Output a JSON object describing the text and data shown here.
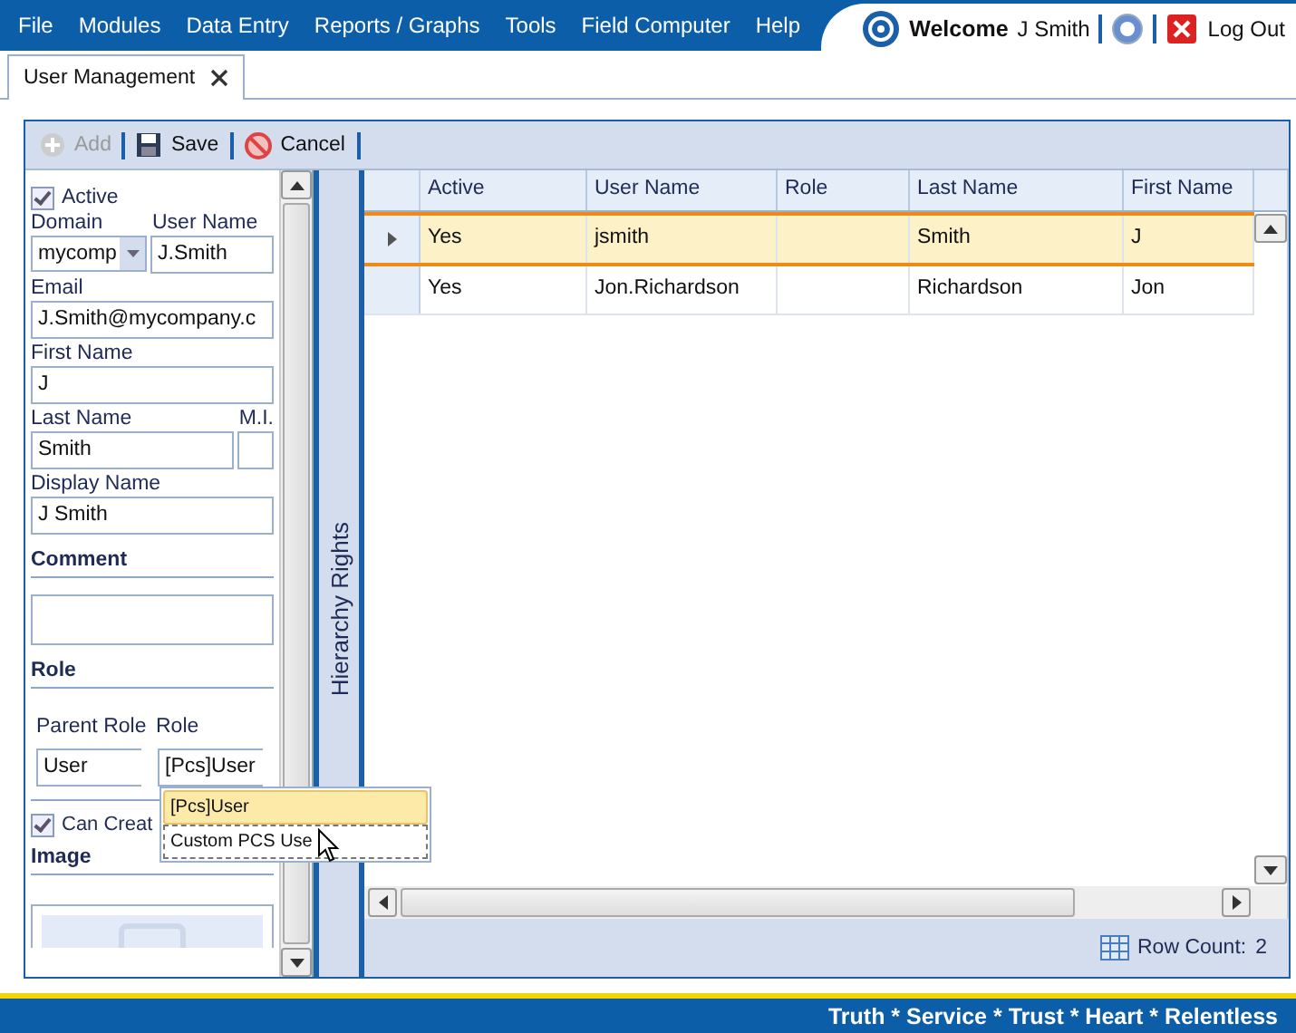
{
  "menu": [
    "File",
    "Modules",
    "Data Entry",
    "Reports / Graphs",
    "Tools",
    "Field Computer",
    "Help"
  ],
  "user": {
    "welcome": "Welcome",
    "name": "J Smith",
    "logout": "Log Out"
  },
  "tabs": [
    {
      "label": "User Management",
      "selected": true
    }
  ],
  "toolbar": [
    {
      "label": "Add",
      "kind": "add",
      "disabled": true
    },
    {
      "label": "Save",
      "kind": "save",
      "disabled": false
    },
    {
      "label": "Cancel",
      "kind": "cancel",
      "disabled": false
    }
  ],
  "form": {
    "active": {
      "label": "Active",
      "checked": true
    },
    "domain": {
      "label": "Domain",
      "value": "mycomp"
    },
    "user_name": {
      "label": "User Name",
      "value": "J.Smith"
    },
    "email": {
      "label": "Email",
      "value": "J.Smith@mycompany.c"
    },
    "first_name": {
      "label": "First Name",
      "value": "J"
    },
    "last_name": {
      "label": "Last Name",
      "value": "Smith"
    },
    "mi": {
      "label": "M.I."
    },
    "display_name": {
      "label": "Display Name",
      "value": "J Smith"
    },
    "comment": {
      "label": "Comment"
    },
    "role_section": "Role",
    "parent_role": {
      "label": "Parent Role",
      "value": "User"
    },
    "role": {
      "label": "Role",
      "value": "[Pcs]User"
    },
    "can_create": {
      "label": "Can Creat",
      "checked": true
    },
    "image_section": "Image"
  },
  "role_dropdown": [
    {
      "label": "[Pcs]User",
      "selected": true
    },
    {
      "label": "Custom PCS Use",
      "selected": false
    }
  ],
  "side_tab": "Hierarchy Rights",
  "table": {
    "columns": [
      "Active",
      "User Name",
      "Role",
      "Last Name",
      "First Name"
    ],
    "rows": [
      {
        "selected": true,
        "cells": [
          "Yes",
          "jsmith",
          "",
          "Smith",
          "J"
        ]
      },
      {
        "selected": false,
        "cells": [
          "Yes",
          "Jon.Richardson",
          "",
          "Richardson",
          "Jon"
        ]
      }
    ]
  },
  "row_count": {
    "label": "Row Count:",
    "value": "2"
  },
  "footer": "Truth * Service * Trust * Heart * Relentless"
}
